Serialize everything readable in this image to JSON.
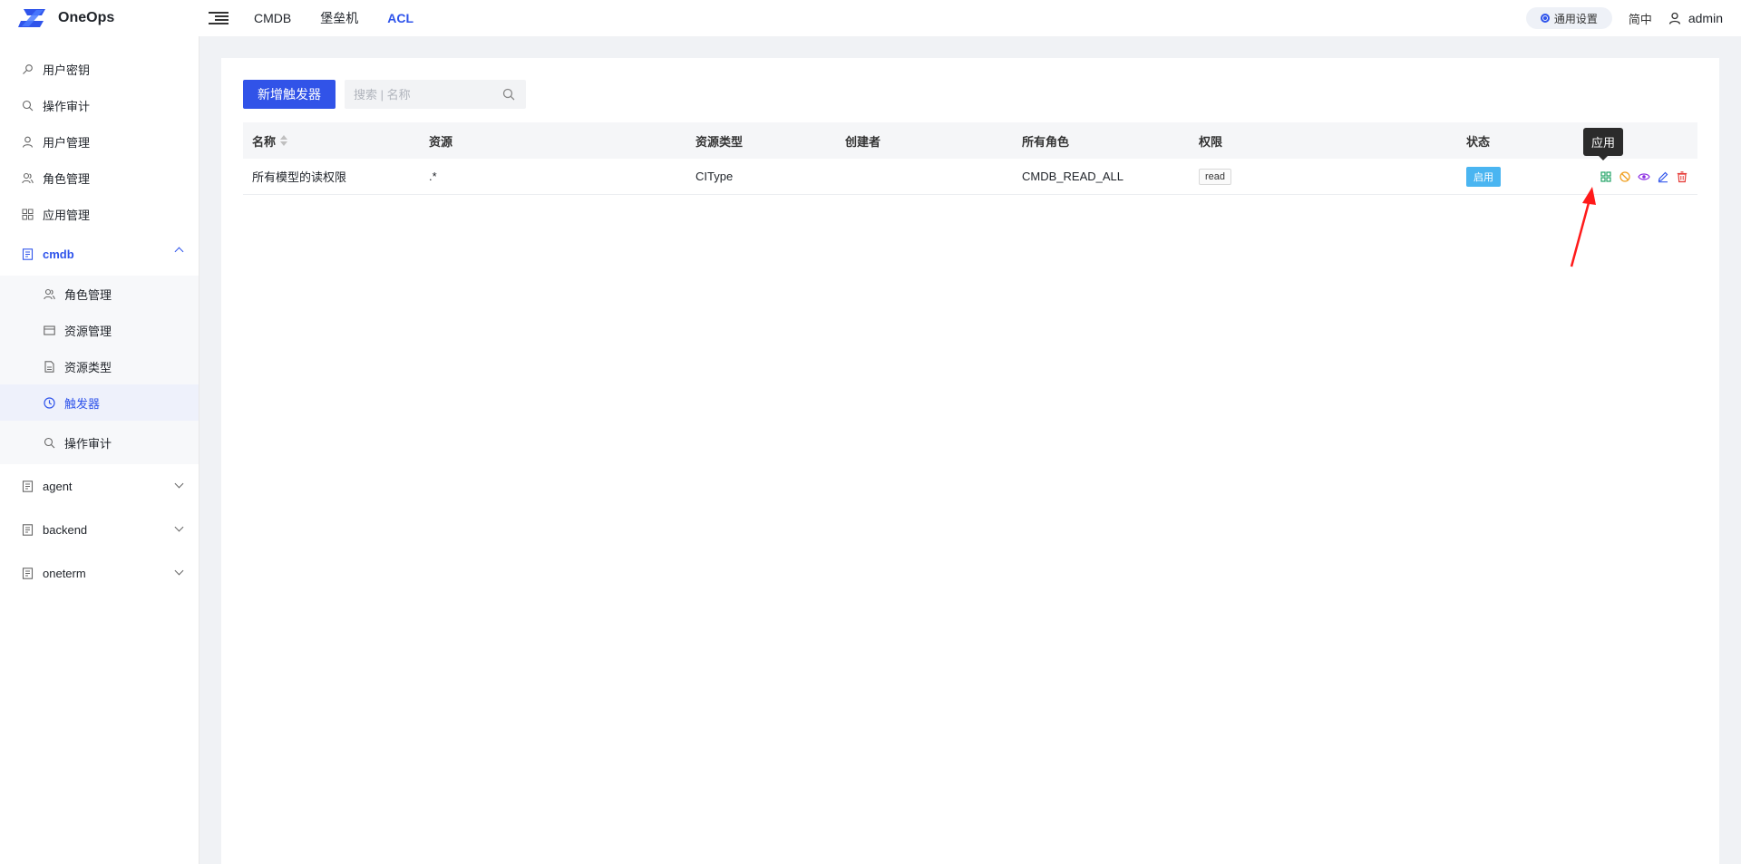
{
  "app": {
    "name": "OneOps"
  },
  "topnav": [
    {
      "label": "CMDB",
      "active": false
    },
    {
      "label": "堡垒机",
      "active": false
    },
    {
      "label": "ACL",
      "active": true
    }
  ],
  "header": {
    "settings_label": "通用设置",
    "lang_label": "简中",
    "user_name": "admin"
  },
  "sidebar": {
    "top_items": [
      {
        "label": "用户密钥",
        "icon": "key-icon"
      },
      {
        "label": "操作审计",
        "icon": "search-icon"
      },
      {
        "label": "用户管理",
        "icon": "user-icon"
      },
      {
        "label": "角色管理",
        "icon": "users-icon"
      },
      {
        "label": "应用管理",
        "icon": "apps-icon"
      }
    ],
    "groups": [
      {
        "label": "cmdb",
        "open": true,
        "children": [
          {
            "label": "角色管理",
            "icon": "users-icon"
          },
          {
            "label": "资源管理",
            "icon": "resource-icon"
          },
          {
            "label": "资源类型",
            "icon": "file-icon"
          },
          {
            "label": "触发器",
            "icon": "clock-icon",
            "selected": true
          },
          {
            "label": "操作审计",
            "icon": "search-icon"
          }
        ]
      },
      {
        "label": "agent",
        "open": false
      },
      {
        "label": "backend",
        "open": false
      },
      {
        "label": "oneterm",
        "open": false
      }
    ]
  },
  "toolbar": {
    "add_button": "新增触发器",
    "search_placeholder": "搜索 | 名称"
  },
  "table": {
    "columns": [
      "名称",
      "资源",
      "资源类型",
      "创建者",
      "所有角色",
      "权限",
      "状态"
    ],
    "rows": [
      {
        "name": "所有模型的读权限",
        "resource": ".*",
        "resource_type": "CIType",
        "creator": "",
        "roles": "CMDB_READ_ALL",
        "permission": "read",
        "status": "启用"
      }
    ]
  },
  "tooltip": {
    "text": "应用"
  },
  "colors": {
    "accent": "#2f54eb",
    "primary_button": "#3153e8",
    "status_badge": "#4ab5f1",
    "arrow": "#ff1a1a"
  }
}
